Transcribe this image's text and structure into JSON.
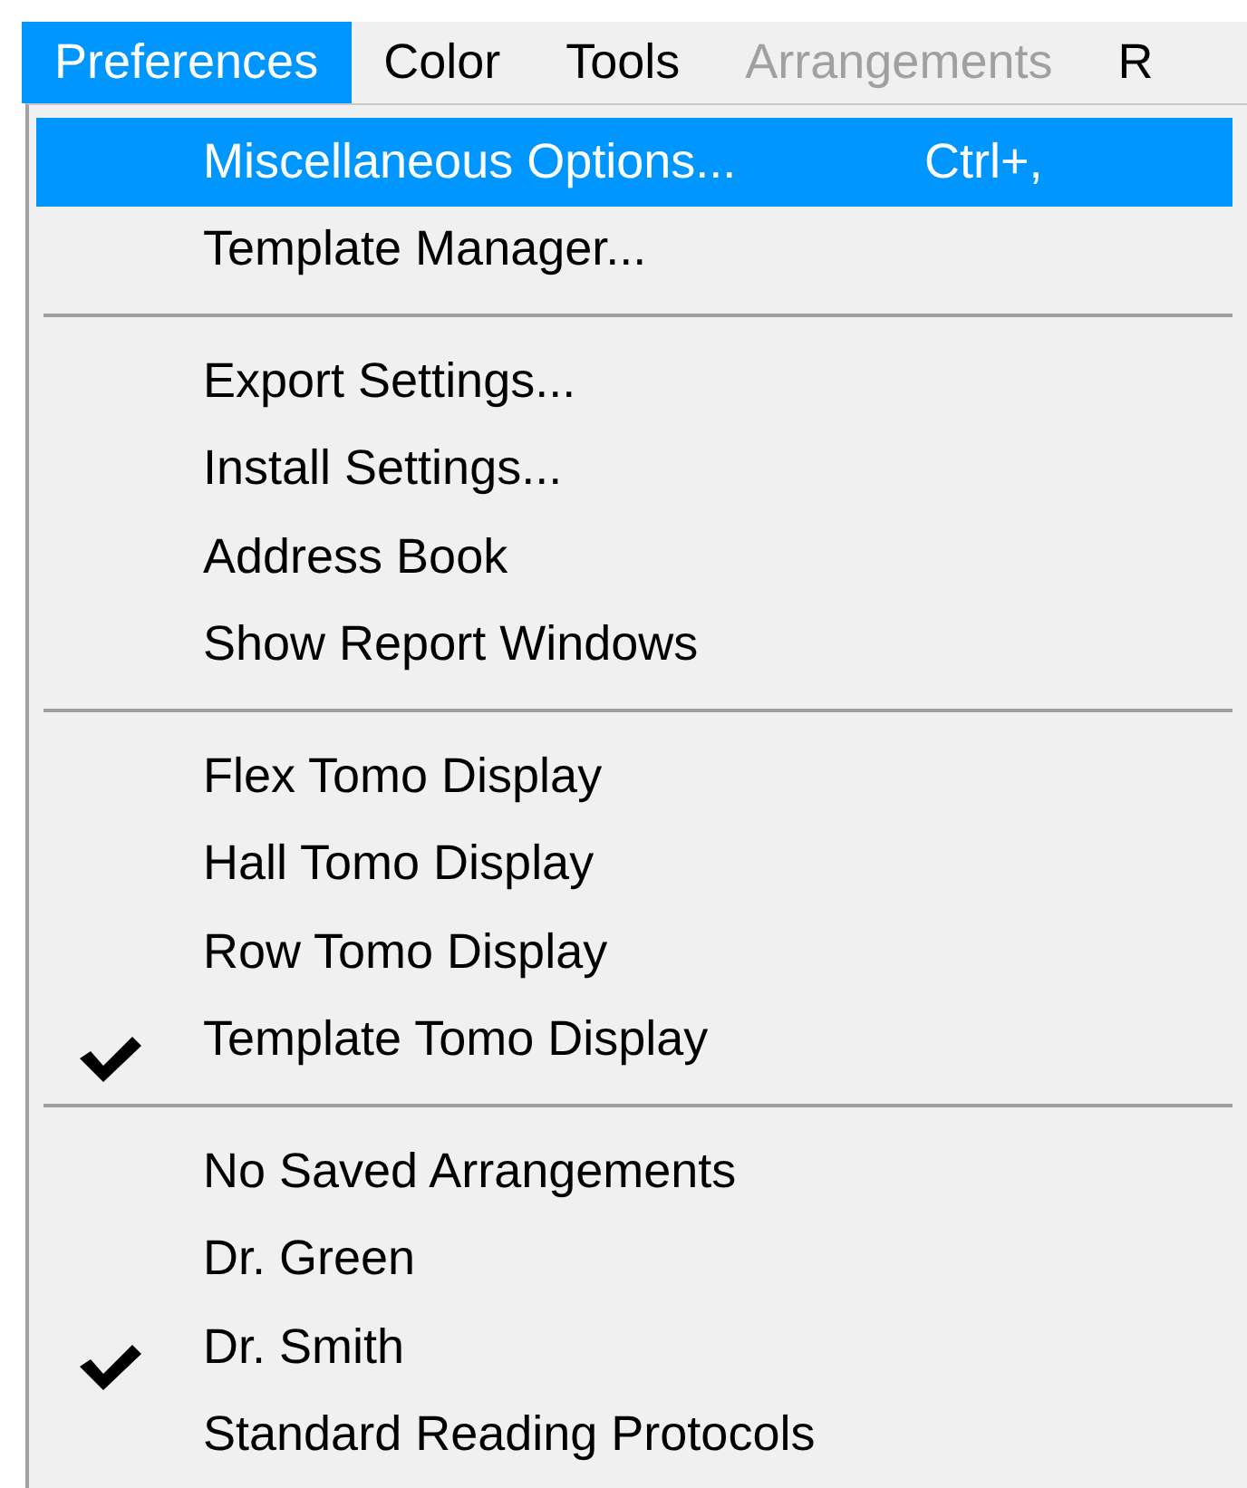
{
  "menubar": [
    {
      "label": "Preferences",
      "selected": true,
      "disabled": false
    },
    {
      "label": "Color",
      "selected": false,
      "disabled": false
    },
    {
      "label": "Tools",
      "selected": false,
      "disabled": false
    },
    {
      "label": "Arrangements",
      "selected": false,
      "disabled": true
    },
    {
      "label": "R",
      "selected": false,
      "disabled": false
    }
  ],
  "menu": {
    "sections": [
      {
        "items": [
          {
            "label": "Miscellaneous Options...",
            "shortcut": "Ctrl+,",
            "selected": true,
            "checked": false
          },
          {
            "label": "Template Manager...",
            "selected": false,
            "checked": false
          }
        ]
      },
      {
        "items": [
          {
            "label": "Export Settings...",
            "selected": false,
            "checked": false
          },
          {
            "label": "Install Settings...",
            "selected": false,
            "checked": false
          },
          {
            "label": "Address Book",
            "selected": false,
            "checked": false
          },
          {
            "label": "Show Report Windows",
            "selected": false,
            "checked": false
          }
        ]
      },
      {
        "items": [
          {
            "label": "Flex Tomo Display",
            "selected": false,
            "checked": false
          },
          {
            "label": "Hall Tomo Display",
            "selected": false,
            "checked": false
          },
          {
            "label": "Row Tomo Display",
            "selected": false,
            "checked": false
          },
          {
            "label": "Template Tomo Display",
            "selected": false,
            "checked": true
          }
        ]
      },
      {
        "items": [
          {
            "label": "No Saved Arrangements",
            "selected": false,
            "checked": false
          },
          {
            "label": "Dr. Green",
            "selected": false,
            "checked": false
          },
          {
            "label": "Dr. Smith",
            "selected": false,
            "checked": true
          },
          {
            "label": "Standard Reading Protocols",
            "selected": false,
            "checked": false
          }
        ]
      }
    ]
  }
}
